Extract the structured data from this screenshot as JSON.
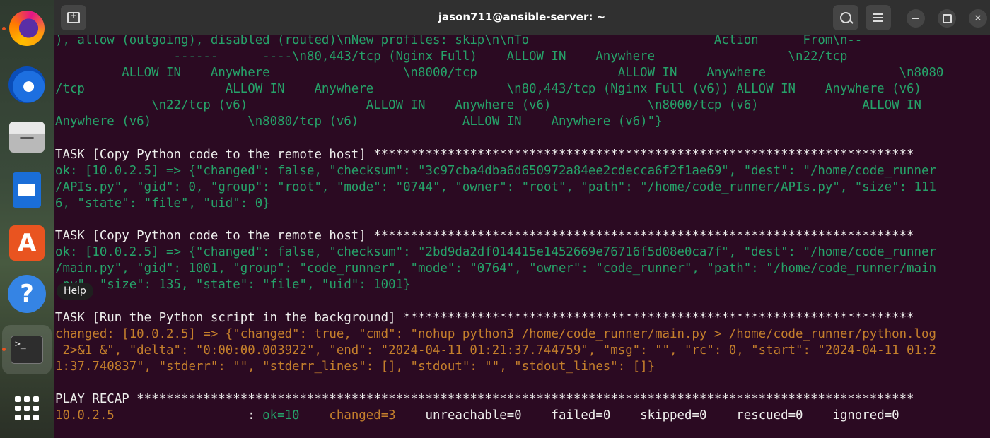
{
  "window": {
    "title": "jason711@ansible-server: ~"
  },
  "dock": {
    "items": [
      "firefox",
      "thunderbird",
      "files",
      "libreoffice-writer",
      "app-center",
      "help",
      "terminal",
      "show-apps"
    ],
    "help_tooltip": "Help"
  },
  "terminal": {
    "lines": [
      {
        "c": "g",
        "t": "), allow (outgoing), disabled (routed)\\nNew profiles: skip\\n\\nTo                         Action      From\\n--"
      },
      {
        "c": "g",
        "t": "                ------      ----\\n80,443/tcp (Nginx Full)    ALLOW IN    Anywhere                  \\n22/tcp"
      },
      {
        "c": "g",
        "t": "         ALLOW IN    Anywhere                  \\n8000/tcp                   ALLOW IN    Anywhere                  \\n8080"
      },
      {
        "c": "g",
        "t": "/tcp                   ALLOW IN    Anywhere                  \\n80,443/tcp (Nginx Full (v6)) ALLOW IN    Anywhere (v6)"
      },
      {
        "c": "g",
        "t": "             \\n22/tcp (v6)                ALLOW IN    Anywhere (v6)             \\n8000/tcp (v6)              ALLOW IN"
      },
      {
        "c": "g",
        "t": "Anywhere (v6)             \\n8080/tcp (v6)              ALLOW IN    Anywhere (v6)\"}"
      },
      {
        "c": "w",
        "t": ""
      },
      {
        "c": "w",
        "t": "TASK [Copy Python code to the remote host] *************************************************************************"
      },
      {
        "c": "g",
        "t": "ok: [10.0.2.5] => {\"changed\": false, \"checksum\": \"3c97cba4dba6d650972a84ee2cdecca6f2f1ae69\", \"dest\": \"/home/code_runner"
      },
      {
        "c": "g",
        "t": "/APIs.py\", \"gid\": 0, \"group\": \"root\", \"mode\": \"0744\", \"owner\": \"root\", \"path\": \"/home/code_runner/APIs.py\", \"size\": 111"
      },
      {
        "c": "g",
        "t": "6, \"state\": \"file\", \"uid\": 0}"
      },
      {
        "c": "w",
        "t": ""
      },
      {
        "c": "w",
        "t": "TASK [Copy Python code to the remote host] *************************************************************************"
      },
      {
        "c": "g",
        "t": "ok: [10.0.2.5] => {\"changed\": false, \"checksum\": \"2bd9da2df014415e1452669e76716f5d08e0ca7f\", \"dest\": \"/home/code_runner"
      },
      {
        "c": "g",
        "t": "/main.py\", \"gid\": 1001, \"group\": \"code_runner\", \"mode\": \"0764\", \"owner\": \"code_runner\", \"path\": \"/home/code_runner/main"
      },
      {
        "c": "g",
        "t": ".py\", \"size\": 135, \"state\": \"file\", \"uid\": 1001}"
      },
      {
        "c": "w",
        "t": ""
      },
      {
        "c": "w",
        "t": "TASK [Run the Python script in the background] *********************************************************************"
      },
      {
        "c": "o",
        "t": "changed: [10.0.2.5] => {\"changed\": true, \"cmd\": \"nohup python3 /home/code_runner/main.py > /home/code_runner/python.log"
      },
      {
        "c": "o",
        "t": " 2>&1 &\", \"delta\": \"0:00:00.003922\", \"end\": \"2024-04-11 01:21:37.744759\", \"msg\": \"\", \"rc\": 0, \"start\": \"2024-04-11 01:2"
      },
      {
        "c": "o",
        "t": "1:37.740837\", \"stderr\": \"\", \"stderr_lines\": [], \"stdout\": \"\", \"stdout_lines\": []}"
      },
      {
        "c": "w",
        "t": ""
      },
      {
        "c": "w",
        "t": "PLAY RECAP *********************************************************************************************************"
      }
    ],
    "recap": {
      "host": "10.0.2.5",
      "sep": "                  : ",
      "ok": "ok=10",
      "changed": "changed=3",
      "rest": "unreachable=0    failed=0    skipped=0    rescued=0    ignored=0"
    }
  }
}
